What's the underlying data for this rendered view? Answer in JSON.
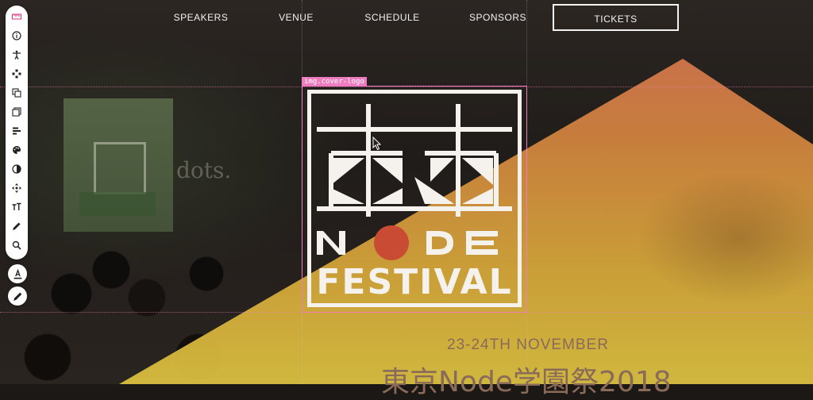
{
  "nav": {
    "items": [
      {
        "label": "SPEAKERS"
      },
      {
        "label": "VENUE"
      },
      {
        "label": "SCHEDULE"
      },
      {
        "label": "SPONSORS"
      },
      {
        "label": "TICKETS"
      }
    ]
  },
  "background_text": "dots.",
  "logo": {
    "selector_tag": "img.cover-logo",
    "wordmark_node": "NODE",
    "wordmark_festival": "FESTIVAL"
  },
  "event": {
    "date": "23-24TH NOVEMBER",
    "title": "東京Node学園祭2018"
  },
  "toolbar": {
    "icons": [
      "ruler-icon",
      "info-icon",
      "accessibility-icon",
      "move-icon",
      "copy-icon",
      "layers-icon",
      "align-icon",
      "palette-icon",
      "contrast-icon",
      "position-icon",
      "text-size-icon",
      "pen-icon",
      "search-icon"
    ],
    "extra_buttons": [
      "text-color-icon",
      "edit-icon"
    ]
  },
  "colors": {
    "accent_triangle_top": "#d86e58",
    "accent_triangle_bottom": "#dcc240",
    "logo_white": "#f5f2ee",
    "logo_red": "#c94b33",
    "selection_pink": "#f07cc0",
    "text_brown": "#8a6a58"
  }
}
